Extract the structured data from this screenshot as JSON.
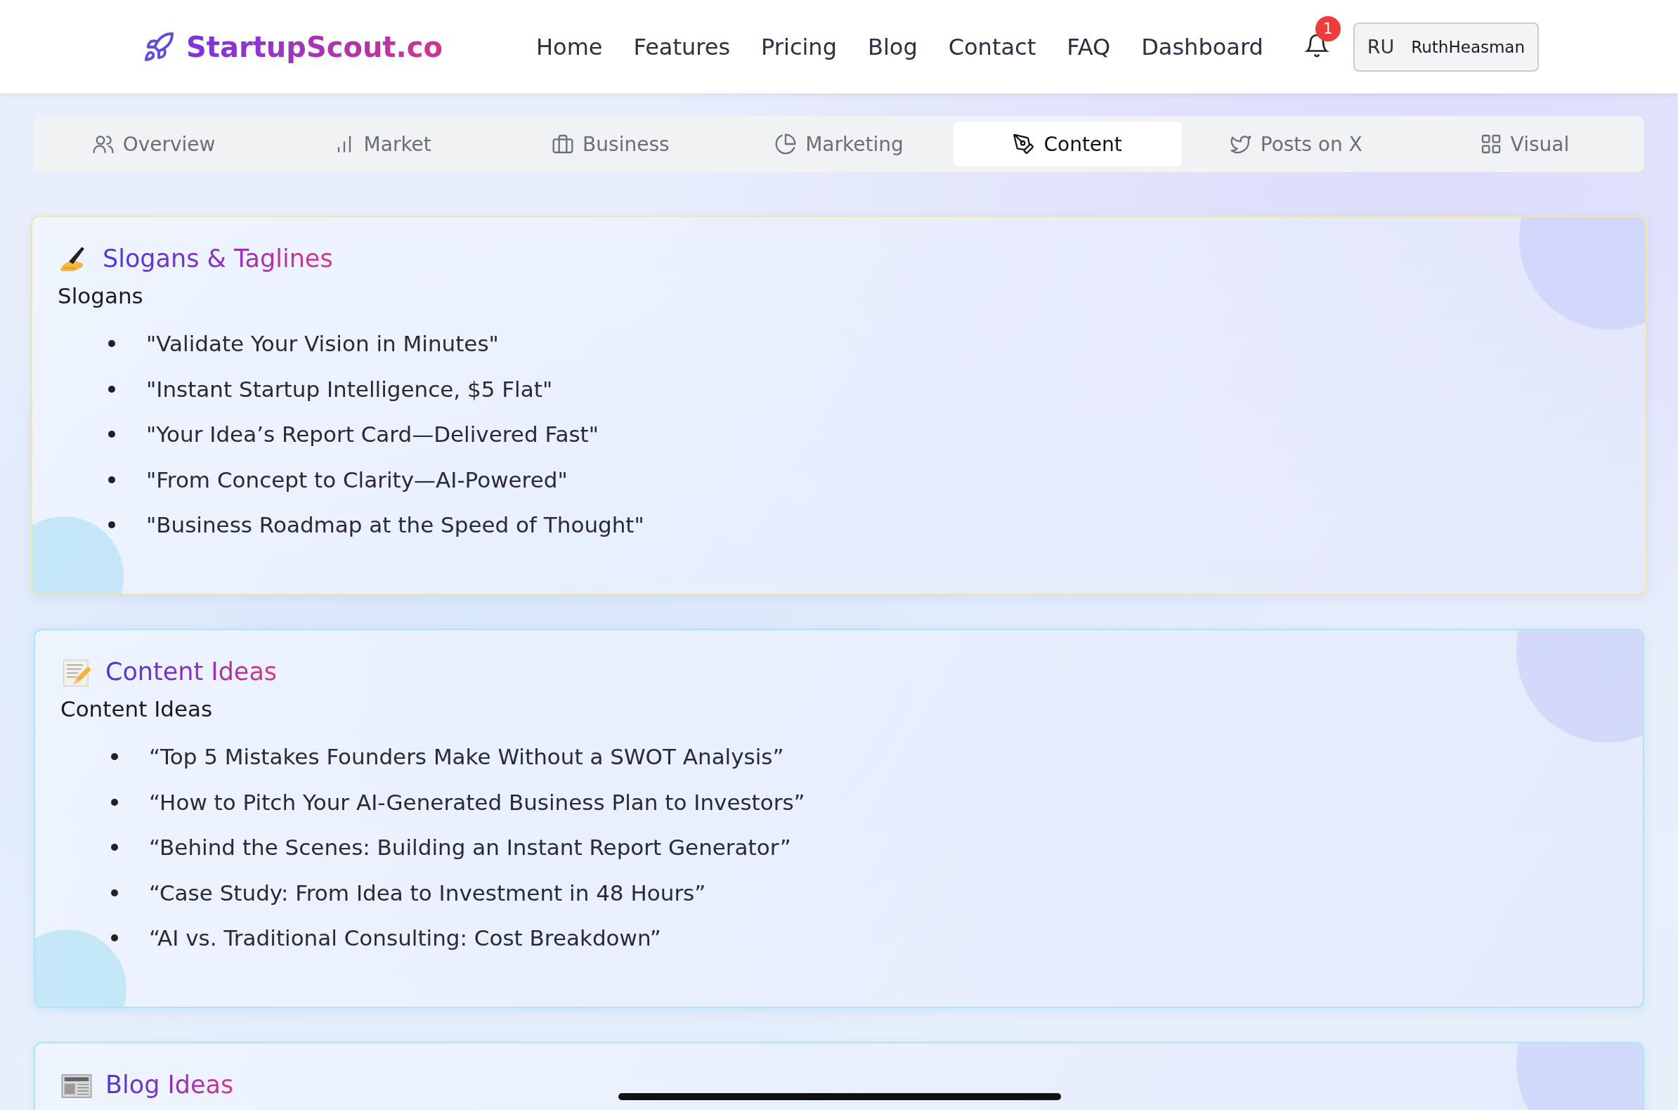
{
  "header": {
    "logo": "StartupScout.co",
    "nav": [
      "Home",
      "Features",
      "Pricing",
      "Blog",
      "Contact",
      "FAQ",
      "Dashboard"
    ],
    "notifications": "1",
    "user": {
      "initials": "RU",
      "name": "RuthHeasman"
    }
  },
  "tabs": [
    {
      "label": "Overview",
      "selected": false
    },
    {
      "label": "Market",
      "selected": false
    },
    {
      "label": "Business",
      "selected": false
    },
    {
      "label": "Marketing",
      "selected": false
    },
    {
      "label": "Content",
      "selected": true
    },
    {
      "label": "Posts on X",
      "selected": false
    },
    {
      "label": "Visual",
      "selected": false
    }
  ],
  "sections": [
    {
      "title": "Slogans & Taglines",
      "subtitle": "Slogans",
      "items": [
        "\"Validate Your Vision in Minutes\"",
        "\"Instant Startup Intelligence, $5 Flat\"",
        "\"Your Idea’s Report Card—Delivered Fast\"",
        "\"From Concept to Clarity—AI-Powered\"",
        "\"Business Roadmap at the Speed of Thought\""
      ]
    },
    {
      "title": "Content Ideas",
      "subtitle": "Content Ideas",
      "items": [
        "“Top 5 Mistakes Founders Make Without a SWOT Analysis”",
        "“How to Pitch Your AI-Generated Business Plan to Investors”",
        "“Behind the Scenes: Building an Instant Report Generator”",
        "“Case Study: From Idea to Investment in 48 Hours”",
        "“AI vs. Traditional Consulting: Cost Breakdown”"
      ]
    },
    {
      "title": "Blog Ideas"
    }
  ]
}
